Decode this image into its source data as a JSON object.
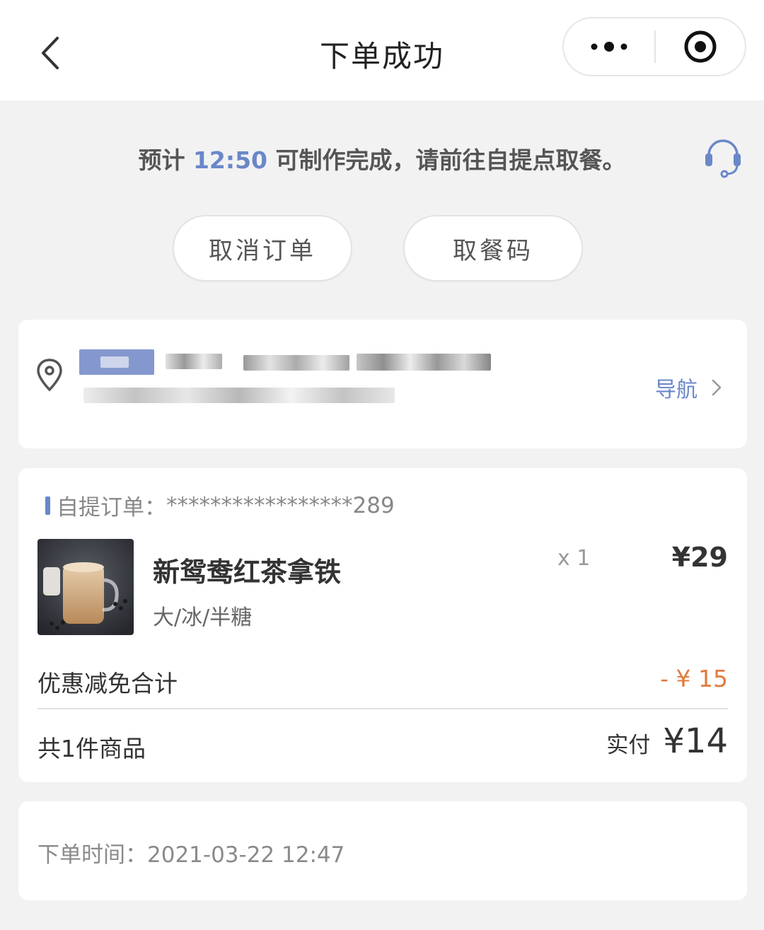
{
  "header": {
    "title": "下单成功",
    "back_icon": "chevron-left-icon",
    "more_icon": "more-dots-icon",
    "close_icon": "target-close-icon"
  },
  "status": {
    "prefix": "预计",
    "time": "12:50",
    "suffix": "可制作完成，请前往自提点取餐。",
    "service_icon": "headset-icon",
    "accent_color": "#6a87c9"
  },
  "actions": {
    "cancel_label": "取消订单",
    "pickup_code_label": "取餐码"
  },
  "store": {
    "pin_icon": "location-pin-icon",
    "nav_label": "导航",
    "nav_icon": "chevron-right-icon"
  },
  "order": {
    "label": "自提订单：",
    "number": "*****************289",
    "product": {
      "name": "新鸳鸯红茶拿铁",
      "spec": "大/冰/半糖",
      "qty": "x 1",
      "price": "¥29"
    },
    "discount_label": "优惠减免合计",
    "discount_value": "- ¥ 15",
    "discount_color": "#e07b3c",
    "count_label": "共1件商品",
    "paid_label": "实付",
    "paid_value": "¥14"
  },
  "order_time": "下单时间：2021-03-22 12:47"
}
